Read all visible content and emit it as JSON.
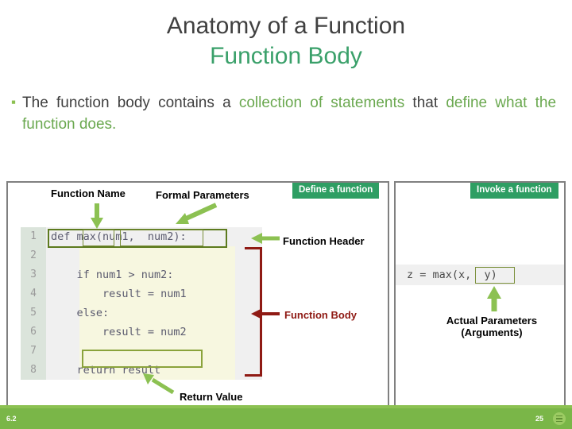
{
  "title": {
    "main": "Anatomy of a Function",
    "sub": "Function Body"
  },
  "bullet": {
    "part1": "The function body contains a ",
    "highlight1": "collection of statements",
    "part2": " that ",
    "highlight2": "define what the function does."
  },
  "panels": {
    "define_tab": "Define a function",
    "invoke_tab": "Invoke a function"
  },
  "code": {
    "line_numbers": [
      "1",
      "2",
      "3",
      "4",
      "5",
      "6",
      "7",
      "8"
    ],
    "lines": [
      "def max(num1,  num2):",
      "",
      "    if num1 > num2:",
      "        result = num1",
      "    else:",
      "        result = num2",
      "",
      "    return result"
    ]
  },
  "invoke": {
    "code": "z = max(x,  y)"
  },
  "labels": {
    "function_name": "Function Name",
    "formal_parameters": "Formal Parameters",
    "function_header": "Function Header",
    "function_body": "Function Body",
    "return_value": "Return Value",
    "actual_parameters_line1": "Actual Parameters",
    "actual_parameters_line2": "(Arguments)"
  },
  "footer": {
    "left": "6.2",
    "page": "25",
    "icon": "menu-icon"
  },
  "colors": {
    "title_dark": "#404040",
    "title_green": "#3aa06a",
    "accent_green": "#6aa84f",
    "tab_green": "#2e9e63",
    "arrow_green": "#8cc152",
    "dark_red": "#8f1a14",
    "footer_green": "#7ab648",
    "code_body_bg": "#f7f7e0"
  }
}
